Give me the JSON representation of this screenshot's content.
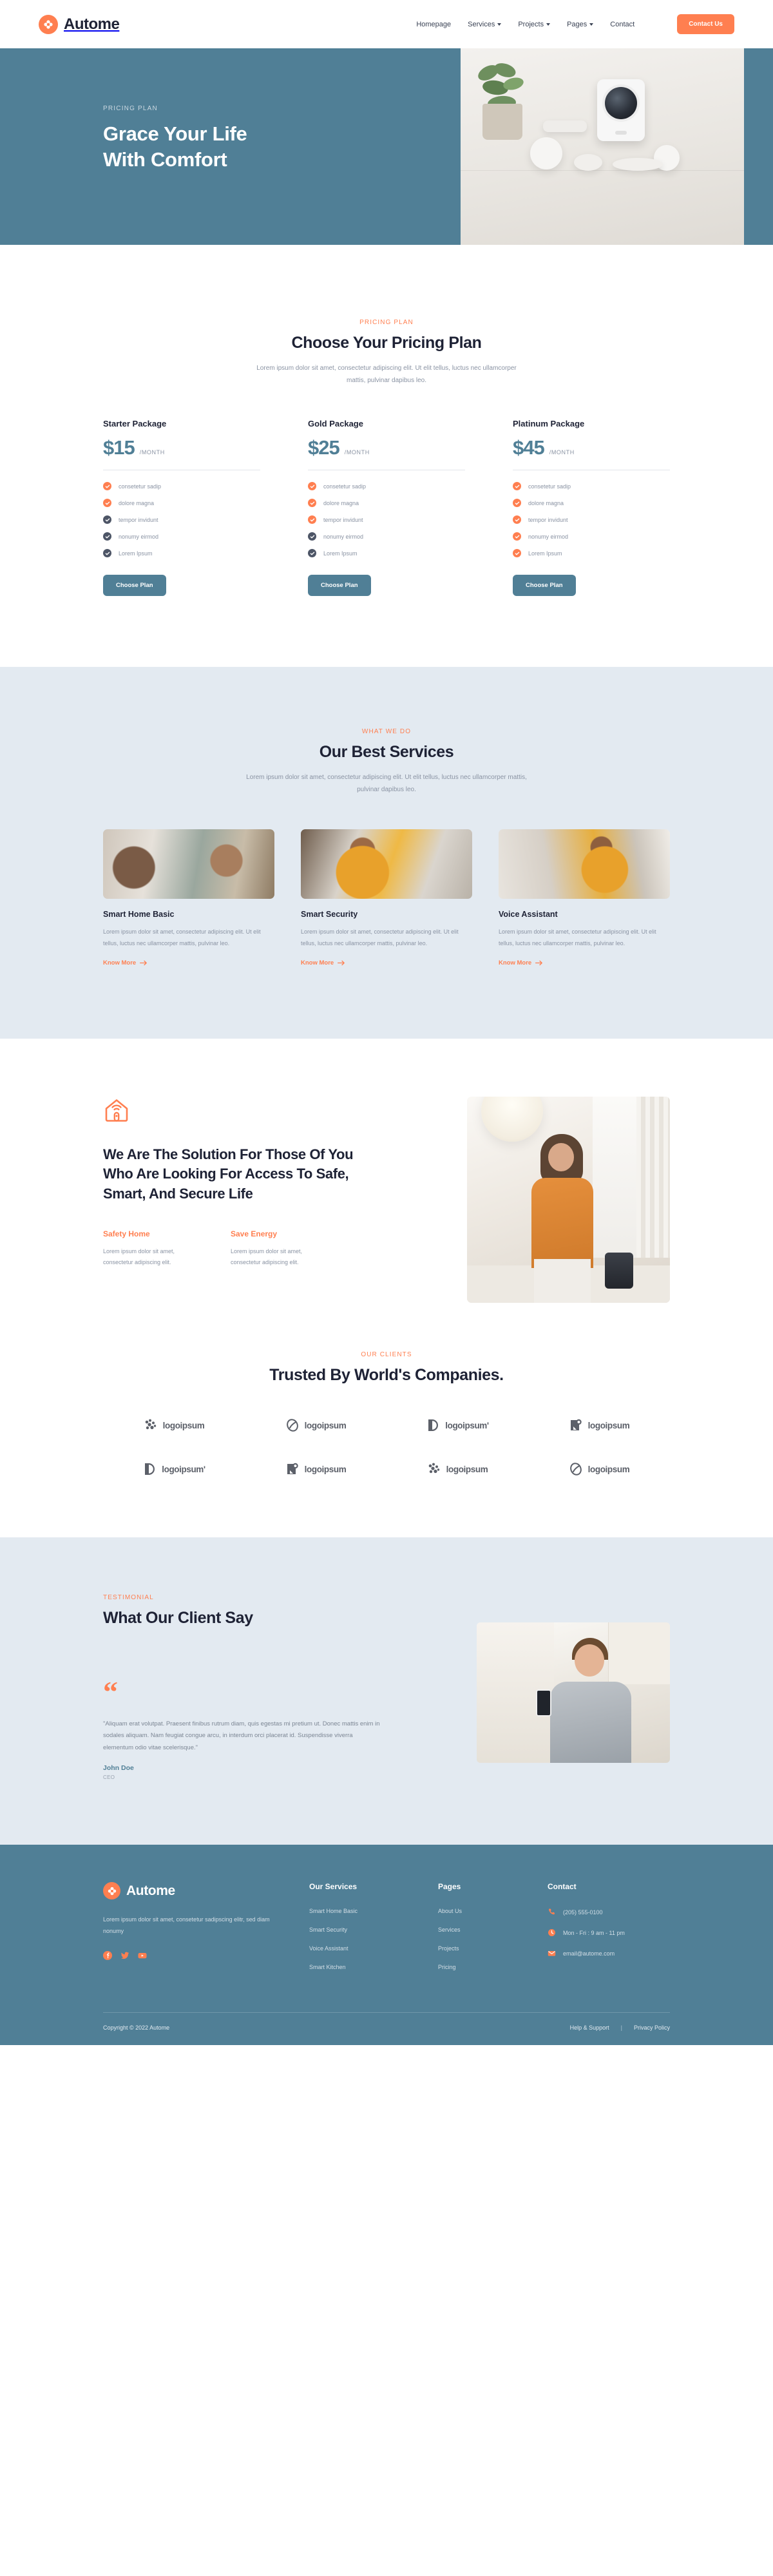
{
  "brand": {
    "name": "Autome",
    "mark_icon": "autome-logo-icon"
  },
  "nav": {
    "links": [
      {
        "label": "Homepage",
        "has_caret": false
      },
      {
        "label": "Services",
        "has_caret": true
      },
      {
        "label": "Projects",
        "has_caret": true
      },
      {
        "label": "Pages",
        "has_caret": true
      },
      {
        "label": "Contact",
        "has_caret": false
      }
    ],
    "cta_label": "Contact Us"
  },
  "hero": {
    "eyebrow": "PRICING PLAN",
    "title_line1": "Grace Your Life",
    "title_line2": "With Comfort",
    "bg_color": "#507F96"
  },
  "pricing": {
    "eyebrow": "PRICING PLAN",
    "title": "Choose Your Pricing Plan",
    "subtitle": "Lorem ipsum dolor sit amet, consectetur adipiscing elit. Ut elit tellus, luctus nec ullamcorper mattis, pulvinar dapibus leo.",
    "per_label": "/MONTH",
    "button_label": "Choose Plan",
    "plans": [
      {
        "name": "Starter Package",
        "price": "$15",
        "features": [
          {
            "label": "consetetur sadip",
            "active": true
          },
          {
            "label": "dolore magna",
            "active": true
          },
          {
            "label": "tempor invidunt",
            "active": false
          },
          {
            "label": "nonumy eirmod",
            "active": false
          },
          {
            "label": "Lorem Ipsum",
            "active": false
          }
        ]
      },
      {
        "name": "Gold Package",
        "price": "$25",
        "features": [
          {
            "label": "consetetur sadip",
            "active": true
          },
          {
            "label": "dolore magna",
            "active": true
          },
          {
            "label": "tempor invidunt",
            "active": true
          },
          {
            "label": "nonumy eirmod",
            "active": false
          },
          {
            "label": "Lorem Ipsum",
            "active": false
          }
        ]
      },
      {
        "name": "Platinum Package",
        "price": "$45",
        "features": [
          {
            "label": "consetetur sadip",
            "active": true
          },
          {
            "label": "dolore magna",
            "active": true
          },
          {
            "label": "tempor invidunt",
            "active": true
          },
          {
            "label": "nonumy eirmod",
            "active": true
          },
          {
            "label": "Lorem Ipsum",
            "active": true
          }
        ]
      }
    ]
  },
  "services": {
    "eyebrow": "WHAT WE DO",
    "title": "Our Best Services",
    "subtitle": "Lorem ipsum dolor sit amet, consectetur adipiscing elit. Ut elit tellus, luctus nec ullamcorper mattis, pulvinar dapibus leo.",
    "link_label": "Know More",
    "cards": [
      {
        "title": "Smart Home Basic",
        "desc": "Lorem ipsum dolor sit amet, consectetur adipiscing elit. Ut elit tellus, luctus nec ullamcorper mattis, pulvinar leo."
      },
      {
        "title": "Smart Security",
        "desc": "Lorem ipsum dolor sit amet, consectetur adipiscing elit. Ut elit tellus, luctus nec ullamcorper mattis, pulvinar leo."
      },
      {
        "title": "Voice Assistant",
        "desc": "Lorem ipsum dolor sit amet, consectetur adipiscing elit. Ut elit tellus, luctus nec ullamcorper mattis, pulvinar leo."
      }
    ]
  },
  "solution": {
    "icon": "smart-home-wifi-icon",
    "title": "We Are The Solution For Those Of You Who Are Looking For Access To Safe, Smart, And Secure Life",
    "features": [
      {
        "title": "Safety Home",
        "desc": "Lorem ipsum dolor sit amet, consectetur adipiscing elit."
      },
      {
        "title": "Save Energy",
        "desc": "Lorem ipsum dolor sit amet, consectetur adipiscing elit."
      }
    ]
  },
  "clients": {
    "eyebrow": "OUR CLIENTS",
    "title": "Trusted By World's Companies.",
    "logos": [
      {
        "text": "logoipsum",
        "icon": "logo-dots-icon"
      },
      {
        "text": "logoipsum",
        "icon": "logo-swirl-icon"
      },
      {
        "text": "logoipsum'",
        "icon": "logo-split-circle-icon"
      },
      {
        "text": "logoipsum",
        "icon": "logo-square-dot-icon"
      },
      {
        "text": "logoipsum'",
        "icon": "logo-split-circle-icon"
      },
      {
        "text": "logoipsum",
        "icon": "logo-square-dot-icon"
      },
      {
        "text": "logoipsum",
        "icon": "logo-dots-icon"
      },
      {
        "text": "logoipsum",
        "icon": "logo-swirl-icon"
      }
    ]
  },
  "testimonial": {
    "eyebrow": "TESTIMONIAL",
    "title": "What Our Client Say",
    "quote_mark": "“",
    "quote": "\"Aliquam erat volutpat. Praesent finibus rutrum diam, quis egestas mi pretium ut. Donec mattis enim in sodales aliquam. Nam feugiat congue arcu, in interdum orci placerat id. Suspendisse viverra elementum odio vitae scelerisque.\"",
    "author": "John Doe",
    "role": "CEO"
  },
  "footer": {
    "brand_name": "Autome",
    "about": "Lorem ipsum dolor sit amet, consetetur sadipscing elitr, sed diam nonumy",
    "socials": [
      {
        "name": "facebook-icon"
      },
      {
        "name": "twitter-icon"
      },
      {
        "name": "youtube-icon"
      }
    ],
    "services": {
      "title": "Our Services",
      "links": [
        "Smart Home Basic",
        "Smart Security",
        "Voice Assistant",
        "Smart Kitchen"
      ]
    },
    "pages": {
      "title": "Pages",
      "links": [
        "About Us",
        "Services",
        "Projects",
        "Pricing"
      ]
    },
    "contact": {
      "title": "Contact",
      "items": [
        {
          "icon": "phone-icon",
          "text": "(205) 555-0100"
        },
        {
          "icon": "clock-icon",
          "text": "Mon - Fri : 9 am - 11 pm"
        },
        {
          "icon": "mail-icon",
          "text": "email@autome.com"
        }
      ]
    },
    "copyright": "Copyright © 2022 Autome",
    "bottom_links": [
      "Help & Support",
      "Privacy Policy"
    ],
    "separator": "|"
  }
}
